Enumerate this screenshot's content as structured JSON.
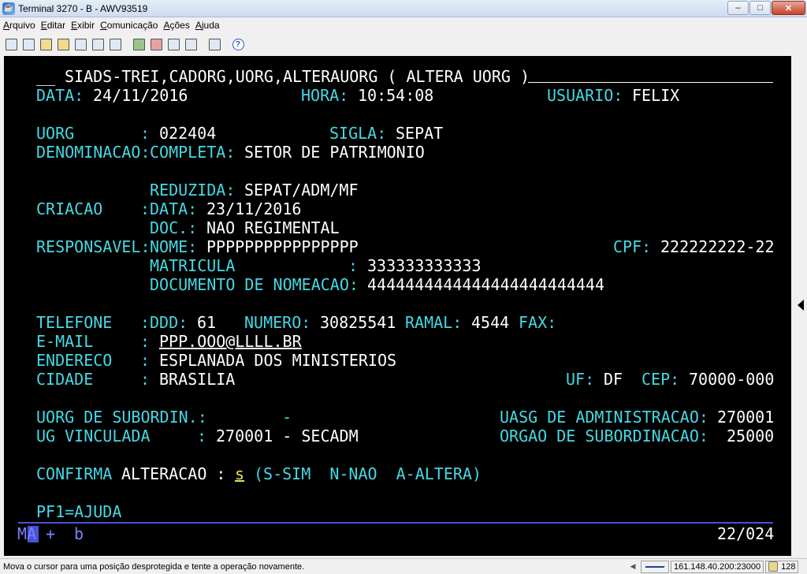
{
  "window": {
    "title": "Terminal 3270 - B - AWV93519",
    "icon": "terminal-app-icon",
    "buttons": {
      "minimize": "–",
      "maximize": "□",
      "close": "✕"
    }
  },
  "menu": [
    "Arquivo",
    "Editar",
    "Exibir",
    "Comunicação",
    "Ações",
    "Ajuda"
  ],
  "toolbar": {
    "icons": [
      "print-screen-icon",
      "print-setup-icon",
      "copy-icon",
      "paste-icon",
      "cut-icon",
      "macro-icon",
      "keypad-icon",
      "send-file-icon",
      "receive-file-icon",
      "connect-icon",
      "disconnect-icon",
      "settings-icon",
      "help-icon"
    ]
  },
  "screen": {
    "header": {
      "prefix": "__",
      "title": "SIADS-TREI,CADORG,UORG,ALTERAUORG ( ALTERA UORG )"
    },
    "data_label": "DATA:",
    "data_value": "24/11/2016",
    "hora_label": "HORA:",
    "hora_value": "10:54:08",
    "usuario_label": "USUARIO:",
    "usuario_value": "FELIX",
    "uorg_label": "UORG",
    "uorg_colon": ":",
    "uorg_value": "022404",
    "sigla_label": "SIGLA:",
    "sigla_value": "SEPAT",
    "denominacao_label": "DENOMINACAO:",
    "completa_label": "COMPLETA:",
    "completa_value": "SETOR DE PATRIMONIO",
    "reduzida_label": "REDUZIDA:",
    "reduzida_value": "SEPAT/ADM/MF",
    "criacao_label": "CRIACAO",
    "criacao_colon": ":",
    "criacao_data_label": "DATA:",
    "criacao_data_value": "23/11/2016",
    "doc_label": "DOC.:",
    "doc_value": "NAO REGIMENTAL",
    "responsavel_label": "RESPONSAVEL:",
    "nome_label": "NOME:",
    "nome_value": "PPPPPPPPPPPPPPPP",
    "cpf_label": "CPF:",
    "cpf_value": "222222222-22",
    "matricula_label": "MATRICULA",
    "matricula_colon": ":",
    "matricula_value": "333333333333",
    "doc_nomeacao_label": "DOCUMENTO DE NOMEACAO:",
    "doc_nomeacao_value": "4444444444444444444444444",
    "telefone_label": "TELEFONE",
    "telefone_colon": ":",
    "ddd_label": "DDD:",
    "ddd_value": "61",
    "numero_label": "NUMERO:",
    "numero_value": "30825541",
    "ramal_label": "RAMAL:",
    "ramal_value": "4544",
    "fax_label": "FAX:",
    "email_label": "E-MAIL",
    "email_colon": ":",
    "email_value": "PPP.OOO@LLLL.BR",
    "endereco_label": "ENDERECO",
    "endereco_colon": ":",
    "endereco_value": "ESPLANADA DOS MINISTERIOS",
    "cidade_label": "CIDADE",
    "cidade_colon": ":",
    "cidade_value": "BRASILIA",
    "uf_label": "UF:",
    "uf_value": "DF",
    "cep_label": "CEP:",
    "cep_value": "70000-000",
    "uorg_subordin_label": "UORG DE SUBORDIN.:",
    "uorg_subordin_value": "-",
    "uasg_label": "UASG DE ADMINISTRACAO:",
    "uasg_value": "270001",
    "ug_vinculada_label": "UG VINCULADA",
    "ug_vinculada_colon": ":",
    "ug_vinculada_value": "270001 - SECADM",
    "orgao_label": "ORGAO DE SUBORDINACAO:",
    "orgao_value": "25000",
    "confirma_label": "CONFIRMA",
    "alteracao_label": "ALTERACAO :",
    "confirma_input": "s",
    "confirma_options": "(S-SIM  N-NAO  A-ALTERA)",
    "pf1_label": "PF1=AJUDA"
  },
  "oia": {
    "mode": "MA",
    "indicator": "+",
    "session": "b",
    "cursor_position": "22/024"
  },
  "statusbar": {
    "message": "Mova o cursor para uma posição desprotegida e tente a operação novamente.",
    "host": "161.148.40.200:23000",
    "count": "128"
  },
  "colors": {
    "terminal_bg": "#000000",
    "field_label": "#45d9e4",
    "field_value": "#ffffff",
    "oia_line": "#4a52d8",
    "cursor": "#f0e050"
  }
}
